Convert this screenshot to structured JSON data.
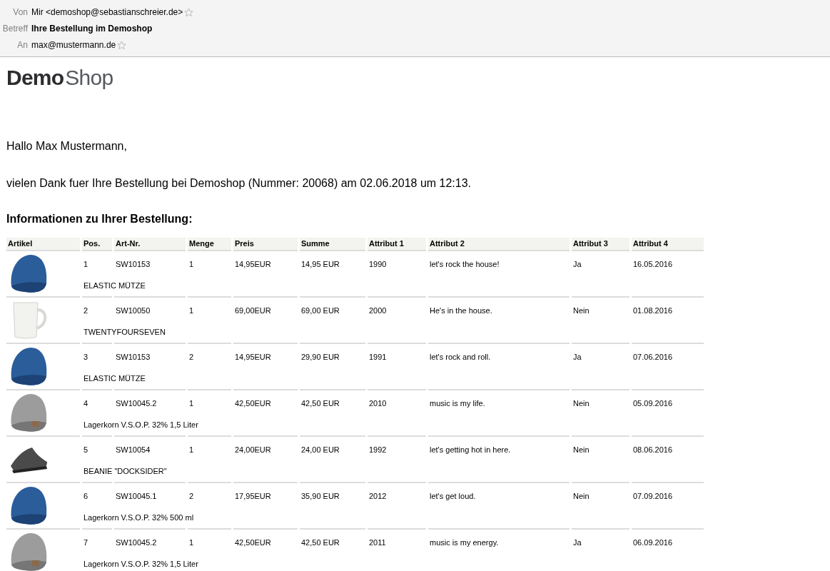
{
  "header": {
    "fields": [
      {
        "label": "Von",
        "value": "Mir <demoshop@sebastianschreier.de>",
        "bold": false,
        "star": true
      },
      {
        "label": "Betreff",
        "value": "Ihre Bestellung im Demoshop",
        "bold": true,
        "star": false
      },
      {
        "label": "An",
        "value": "max@mustermann.de",
        "bold": false,
        "star": true
      }
    ]
  },
  "logo": {
    "part_1": "Demo",
    "part_2": "Shop"
  },
  "greeting": "Hallo Max Mustermann,",
  "intro": "vielen Dank fuer Ihre Bestellung bei Demoshop (Nummer: 20068) am 02.06.2018 um 12:13.",
  "section_title": "Informationen zu Ihrer Bestellung:",
  "table": {
    "columns": [
      "Artikel",
      "Pos.",
      "Art-Nr.",
      "Menge",
      "Preis",
      "Summe",
      "Attribut 1",
      "Attribut 2",
      "Attribut 3",
      "Attribut 4"
    ],
    "rows": [
      {
        "kind": "blue-beanie",
        "cells": [
          "",
          "1",
          "SW10153",
          "1",
          "14,95EUR",
          "14,95 EUR",
          "1990",
          "let's rock the house!",
          "Ja",
          "16.05.2016"
        ],
        "name": "ELASTIC MÜTZE"
      },
      {
        "kind": "mug",
        "cells": [
          "",
          "2",
          "SW10050",
          "1",
          "69,00EUR",
          "69,00 EUR",
          "2000",
          "He's in the house.",
          "Nein",
          "01.08.2016"
        ],
        "name": "TWENTYFOURSEVEN"
      },
      {
        "kind": "blue-beanie",
        "cells": [
          "",
          "3",
          "SW10153",
          "2",
          "14,95EUR",
          "29,90 EUR",
          "1991",
          "let's rock and roll.",
          "Ja",
          "07.06.2016"
        ],
        "name": "ELASTIC MÜTZE"
      },
      {
        "kind": "grey-beanie",
        "cells": [
          "",
          "4",
          "SW10045.2",
          "1",
          "42,50EUR",
          "42,50 EUR",
          "2010",
          "music is my life.",
          "Nein",
          "05.09.2016"
        ],
        "name": "Lagerkorn V.S.O.P. 32% 1,5 Liter"
      },
      {
        "kind": "sneaker",
        "cells": [
          "",
          "5",
          "SW10054",
          "1",
          "24,00EUR",
          "24,00 EUR",
          "1992",
          "let's getting hot in here.",
          "Nein",
          "08.06.2016"
        ],
        "name": "BEANIE \"DOCKSIDER\""
      },
      {
        "kind": "blue-beanie",
        "cells": [
          "",
          "6",
          "SW10045.1",
          "2",
          "17,95EUR",
          "35,90 EUR",
          "2012",
          "let's get loud.",
          "Nein",
          "07.09.2016"
        ],
        "name": "Lagerkorn V.S.O.P. 32% 500 ml"
      },
      {
        "kind": "grey-beanie",
        "cells": [
          "",
          "7",
          "SW10045.2",
          "1",
          "42,50EUR",
          "42,50 EUR",
          "2011",
          "music is my energy.",
          "Ja",
          "06.09.2016"
        ],
        "name": "Lagerkorn V.S.O.P. 32% 1,5 Liter"
      }
    ]
  }
}
